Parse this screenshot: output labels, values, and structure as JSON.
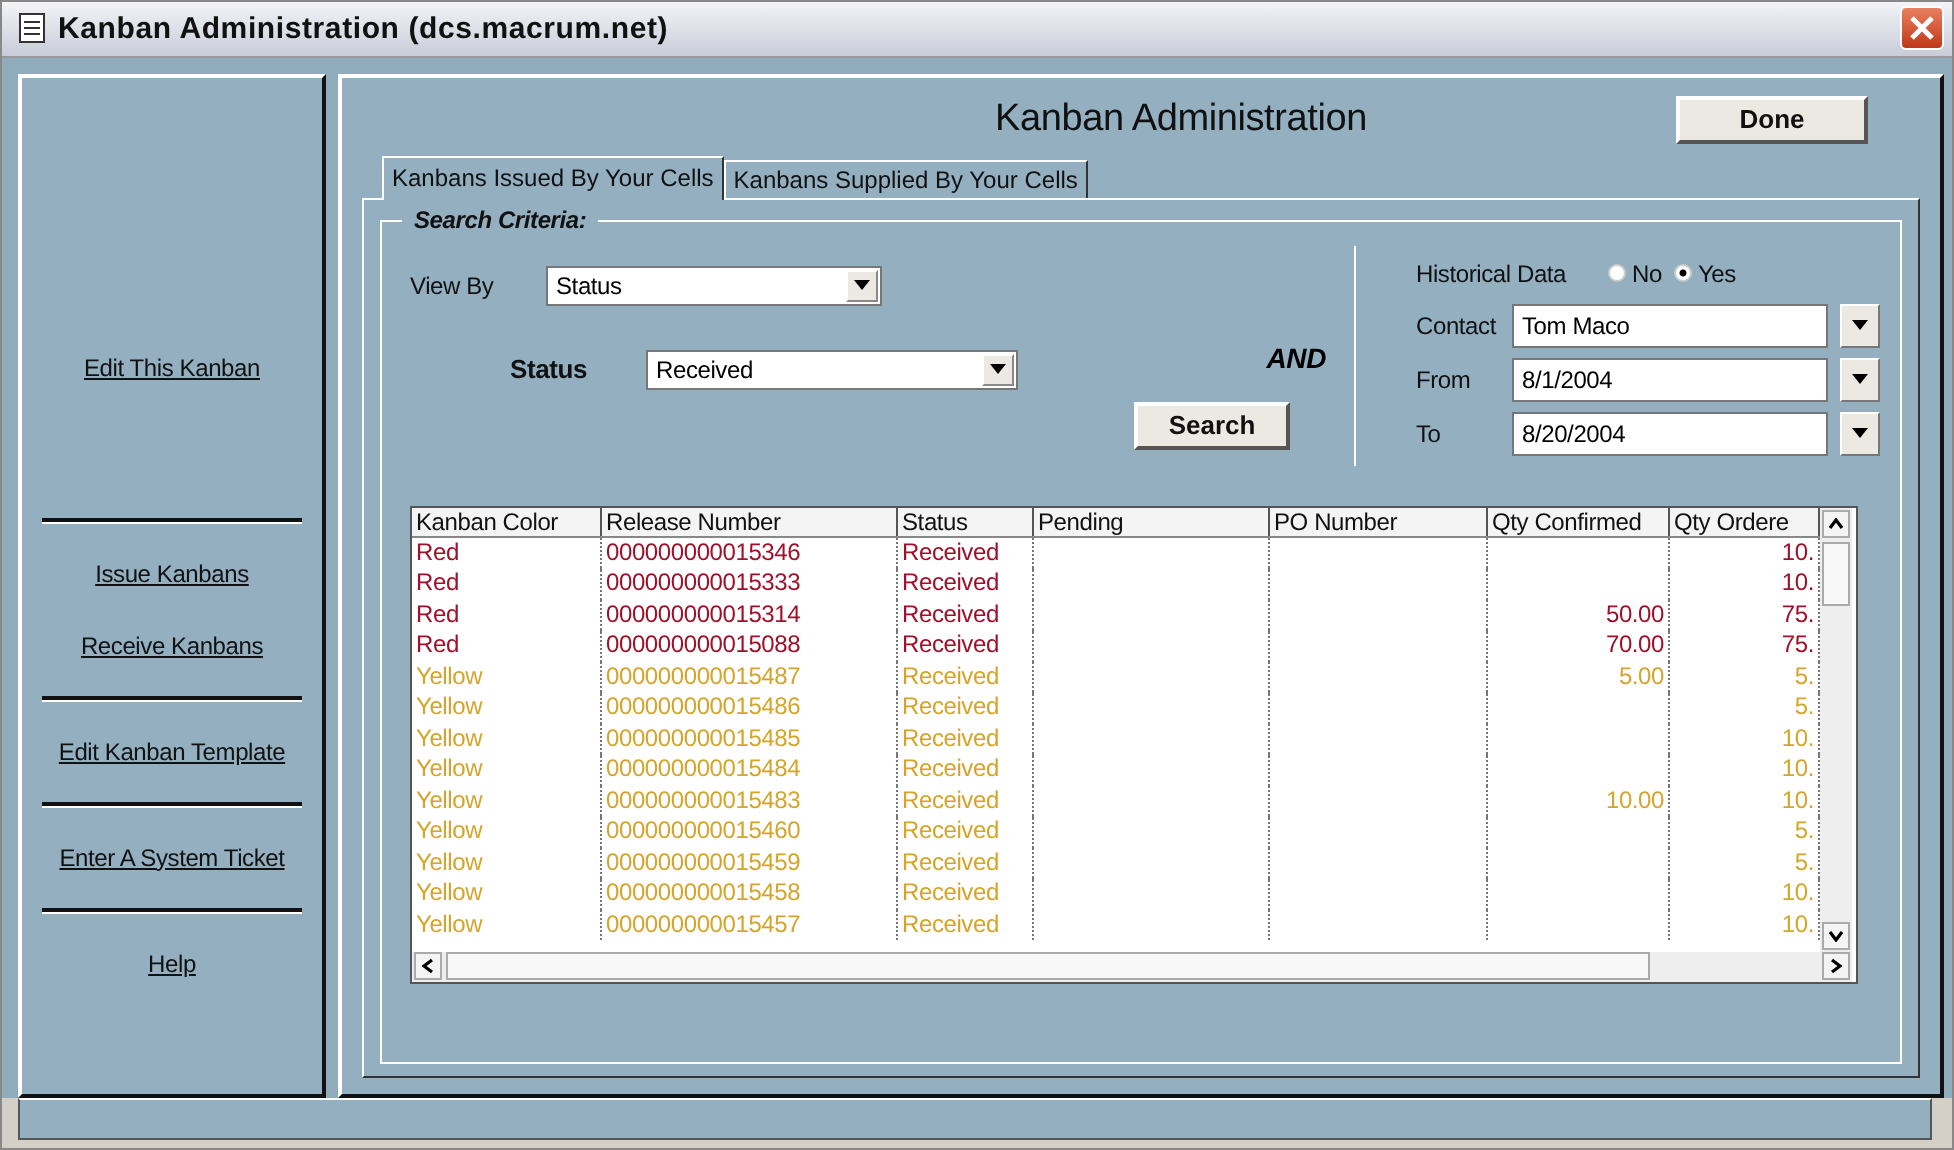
{
  "window": {
    "title": "Kanban Administration (dcs.macrum.net)"
  },
  "sidebar": {
    "groups": [
      [
        "Edit This Kanban"
      ],
      [
        "Issue Kanbans",
        "Receive Kanbans"
      ],
      [
        "Edit Kanban Template"
      ],
      [
        "Enter A System Ticket"
      ],
      [
        "Help"
      ]
    ]
  },
  "header": {
    "title": "Kanban Administration",
    "done_button": "Done"
  },
  "tabs": [
    {
      "label": "Kanbans Issued By Your Cells",
      "selected": true
    },
    {
      "label": "Kanbans Supplied By Your Cells",
      "selected": false
    }
  ],
  "search": {
    "legend": "Search Criteria:",
    "view_by": {
      "label": "View By",
      "value": "Status"
    },
    "status": {
      "label": "Status",
      "value": "Received"
    },
    "connector": "AND",
    "search_button": "Search",
    "historical": {
      "label": "Historical Data",
      "options": [
        {
          "label": "No",
          "selected": false
        },
        {
          "label": "Yes",
          "selected": true
        }
      ]
    },
    "fields": [
      {
        "label": "Contact",
        "value": "Tom Maco"
      },
      {
        "label": "From",
        "value": "8/1/2004"
      },
      {
        "label": "To",
        "value": "8/20/2004"
      }
    ]
  },
  "table": {
    "columns": [
      "Kanban Color",
      "Release Number",
      "Status",
      "Pending",
      "PO Number",
      "Qty Confirmed",
      "Qty Ordere"
    ],
    "rows": [
      {
        "color": "#a0102a",
        "cells": [
          "Red",
          "000000000015346",
          "Received",
          "",
          "",
          "",
          "10."
        ]
      },
      {
        "color": "#a0102a",
        "cells": [
          "Red",
          "000000000015333",
          "Received",
          "",
          "",
          "",
          "10."
        ]
      },
      {
        "color": "#a0102a",
        "cells": [
          "Red",
          "000000000015314",
          "Received",
          "",
          "",
          "50.00",
          "75."
        ]
      },
      {
        "color": "#a0102a",
        "cells": [
          "Red",
          "000000000015088",
          "Received",
          "",
          "",
          "70.00",
          "75."
        ]
      },
      {
        "color": "#d4a52a",
        "cells": [
          "Yellow",
          "000000000015487",
          "Received",
          "",
          "",
          "5.00",
          "5."
        ]
      },
      {
        "color": "#d4a52a",
        "cells": [
          "Yellow",
          "000000000015486",
          "Received",
          "",
          "",
          "",
          "5."
        ]
      },
      {
        "color": "#d4a52a",
        "cells": [
          "Yellow",
          "000000000015485",
          "Received",
          "",
          "",
          "",
          "10."
        ]
      },
      {
        "color": "#d4a52a",
        "cells": [
          "Yellow",
          "000000000015484",
          "Received",
          "",
          "",
          "",
          "10."
        ]
      },
      {
        "color": "#d4a52a",
        "cells": [
          "Yellow",
          "000000000015483",
          "Received",
          "",
          "",
          "10.00",
          "10."
        ]
      },
      {
        "color": "#d4a52a",
        "cells": [
          "Yellow",
          "000000000015460",
          "Received",
          "",
          "",
          "",
          "5."
        ]
      },
      {
        "color": "#d4a52a",
        "cells": [
          "Yellow",
          "000000000015459",
          "Received",
          "",
          "",
          "",
          "5."
        ]
      },
      {
        "color": "#d4a52a",
        "cells": [
          "Yellow",
          "000000000015458",
          "Received",
          "",
          "",
          "",
          "10."
        ]
      },
      {
        "color": "#d4a52a",
        "cells": [
          "Yellow",
          "000000000015457",
          "Received",
          "",
          "",
          "",
          "10."
        ]
      }
    ]
  }
}
